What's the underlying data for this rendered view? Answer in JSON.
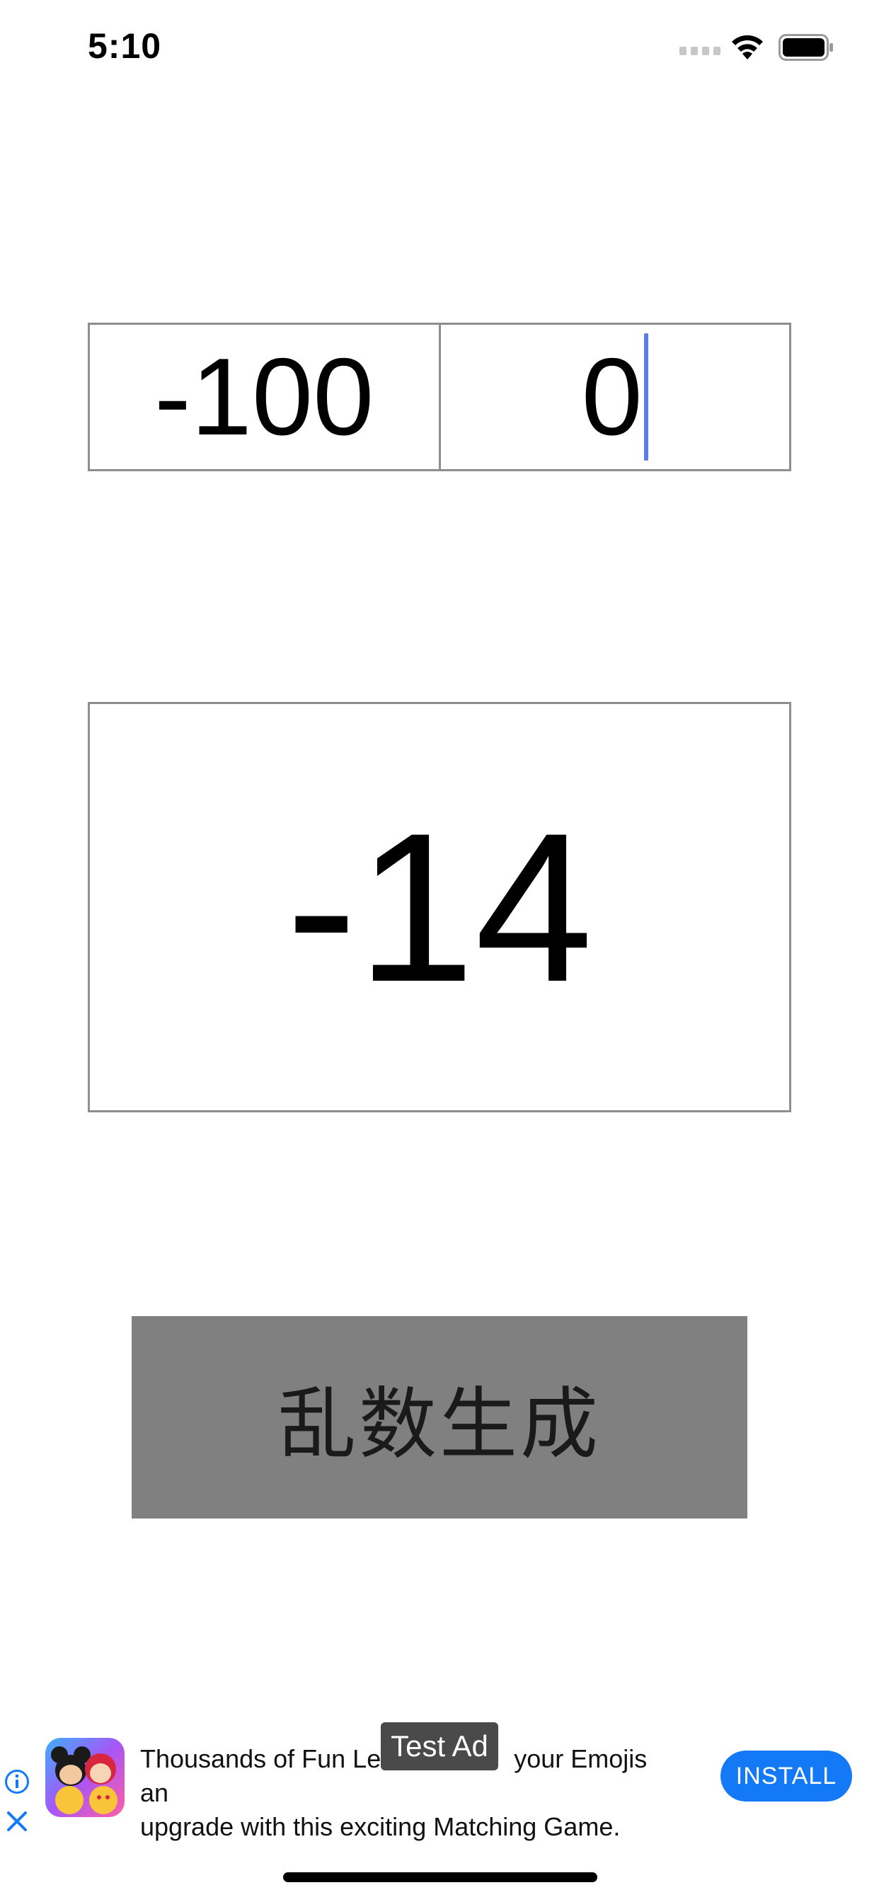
{
  "status_bar": {
    "time": "5:10"
  },
  "range": {
    "min_value": "-100",
    "max_value": "0"
  },
  "result": {
    "value": "-14"
  },
  "generate_button": {
    "label": "乱数生成"
  },
  "ad": {
    "test_label": "Test Ad",
    "text_line1": "Thousands of Fun Lev",
    "text_line1_end": "your Emojis an",
    "text_line2": "upgrade with this exciting Matching Game.",
    "install_label": "INSTALL",
    "accent_color": "#1479f6"
  },
  "colors": {
    "field_border": "#8e8e8e",
    "button_bg": "#808080",
    "cursor": "#5b7de6"
  },
  "icons": [
    "signal-icon",
    "wifi-icon",
    "battery-icon",
    "info-icon",
    "close-icon",
    "app-icon"
  ]
}
